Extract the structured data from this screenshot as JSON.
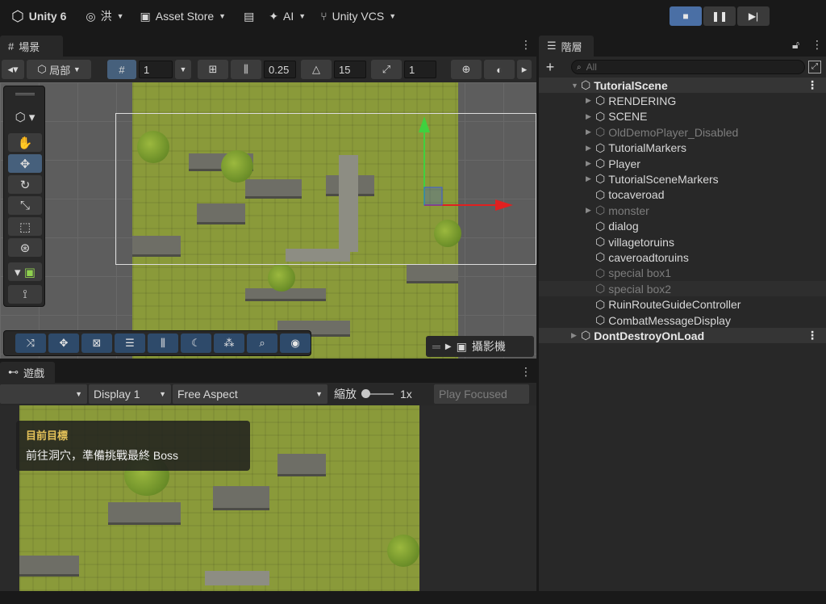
{
  "topbar": {
    "logo_label": "Unity 6",
    "account_label": "洪",
    "asset_store_label": "Asset Store",
    "ai_label": "AI",
    "vcs_label": "Unity VCS"
  },
  "scene": {
    "tab_label": "場景",
    "pivot_label": "局部",
    "grid_value": "1",
    "snap_value": "0.25",
    "rotate_snap_value": "15",
    "scale_snap_value": "1",
    "camera_overlay_label": "攝影機"
  },
  "game": {
    "tab_label": "遊戲",
    "display_label": "Display 1",
    "aspect_label": "Free Aspect",
    "scale_label": "縮放",
    "scale_value": "1x",
    "play_focused_label": "Play Focused",
    "objective_title": "目前目標",
    "objective_text": "前往洞穴，準備挑戰最終 Boss"
  },
  "hierarchy": {
    "tab_label": "階層",
    "search_placeholder": "All",
    "items": [
      {
        "label": "TutorialScene",
        "state": "scene"
      },
      {
        "label": "RENDERING",
        "state": "normal"
      },
      {
        "label": "SCENE",
        "state": "normal"
      },
      {
        "label": "OldDemoPlayer_Disabled",
        "state": "dim"
      },
      {
        "label": "TutorialMarkers",
        "state": "normal"
      },
      {
        "label": "Player",
        "state": "normal"
      },
      {
        "label": "TutorialSceneMarkers",
        "state": "normal"
      },
      {
        "label": "tocaveroad",
        "state": "normal"
      },
      {
        "label": "monster",
        "state": "dim"
      },
      {
        "label": "dialog",
        "state": "normal"
      },
      {
        "label": "villagetoruins",
        "state": "normal"
      },
      {
        "label": "caveroadtoruins",
        "state": "normal"
      },
      {
        "label": "special box1",
        "state": "dim"
      },
      {
        "label": "special box2",
        "state": "dim-selected"
      },
      {
        "label": "RuinRouteGuideController",
        "state": "normal"
      },
      {
        "label": "CombatMessageDisplay",
        "state": "normal"
      },
      {
        "label": "DontDestroyOnLoad",
        "state": "scene"
      }
    ]
  },
  "colors": {
    "accent": "#46607c",
    "grass": "#8a9a3a",
    "gizmo_y": "#3fd13f",
    "gizmo_x": "#e02020"
  }
}
